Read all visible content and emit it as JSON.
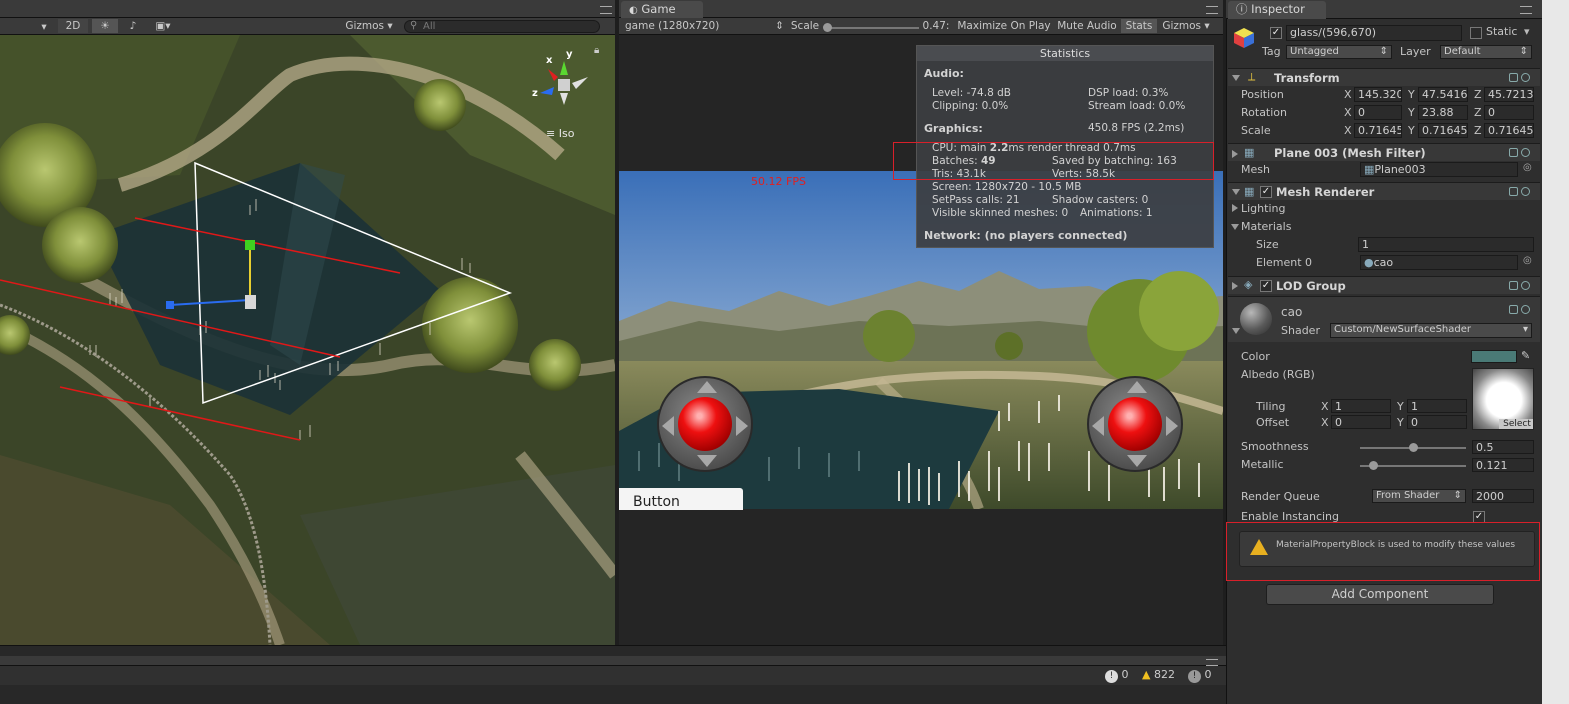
{
  "scene_view": {
    "toolbar": {
      "mode_2d": "2D",
      "gizmos": "Gizmos",
      "search_placeholder": "All"
    },
    "iso_label": "Iso",
    "axis_x": "x",
    "axis_y": "y",
    "axis_z": "z"
  },
  "game_view": {
    "tab_title": "Game",
    "resolution": "game (1280x720)",
    "scale_label": "Scale",
    "scale_value": "0.47:",
    "maximize": "Maximize On Play",
    "mute": "Mute Audio",
    "stats": "Stats",
    "gizmos": "Gizmos",
    "fps_overlay": "50.12 FPS",
    "ui_button": "Button"
  },
  "statistics": {
    "title": "Statistics",
    "audio_heading": "Audio:",
    "level": "Level: -74.8 dB",
    "dsp_load": "DSP load: 0.3%",
    "clipping": "Clipping: 0.0%",
    "stream_load": "Stream load: 0.0%",
    "graphics_heading": "Graphics:",
    "fps": "450.8 FPS (2.2ms)",
    "cpu_prefix": "CPU: main ",
    "cpu_main": "2.2",
    "cpu_suffix": "ms  render thread 0.7ms",
    "batches_prefix": "Batches: ",
    "batches": "49",
    "saved_batching": "Saved by batching: 163",
    "tris": "Tris: 43.1k",
    "verts": "Verts: 58.5k",
    "screen": "Screen: 1280x720 - 10.5 MB",
    "setpass": "SetPass calls: 21",
    "shadow_casters": "Shadow casters: 0",
    "visible_skinned": "Visible skinned meshes: 0",
    "animations": "Animations: 1",
    "network": "Network: (no players connected)"
  },
  "inspector": {
    "tab_title": "Inspector",
    "object_name": "glass/(596,670)",
    "static_label": "Static",
    "tag_label": "Tag",
    "tag_value": "Untagged",
    "layer_label": "Layer",
    "layer_value": "Default",
    "transform": {
      "title": "Transform",
      "position_label": "Position",
      "rotation_label": "Rotation",
      "scale_label": "Scale",
      "x": "X",
      "y": "Y",
      "z": "Z",
      "position": [
        "145.320",
        "47.5416",
        "45.7213"
      ],
      "rotation": [
        "0",
        "23.88",
        "0"
      ],
      "scale": [
        "0.71645",
        "0.71645",
        "0.71645"
      ]
    },
    "mesh_filter": {
      "title": "Plane 003 (Mesh Filter)",
      "mesh_label": "Mesh",
      "mesh_value": "Plane003"
    },
    "mesh_renderer": {
      "title": "Mesh Renderer",
      "lighting": "Lighting",
      "materials": "Materials",
      "size_label": "Size",
      "size_value": "1",
      "element_label": "Element 0",
      "element_value": "cao"
    },
    "lod_group": {
      "title": "LOD Group"
    },
    "material": {
      "name": "cao",
      "shader_label": "Shader",
      "shader_value": "Custom/NewSurfaceShader",
      "color_label": "Color",
      "albedo_label": "Albedo (RGB)",
      "tiling_label": "Tiling",
      "offset_label": "Offset",
      "tiling": [
        "1",
        "1"
      ],
      "offset": [
        "0",
        "0"
      ],
      "select": "Select",
      "smoothness_label": "Smoothness",
      "smoothness_value": "0.5",
      "smoothness_level": 0.5,
      "metallic_label": "Metallic",
      "metallic_value": "0.121",
      "metallic_level": 0.121,
      "render_queue_label": "Render Queue",
      "render_queue_mode": "From Shader",
      "render_queue_value": "2000",
      "instancing_label": "Enable Instancing",
      "warning": "MaterialPropertyBlock is used to modify these values"
    },
    "add_component": "Add Component"
  },
  "console": {
    "errors": "0",
    "warnings": "822",
    "messages": "0"
  },
  "colors": {
    "highlight_box": "#d8202a",
    "fps_overlay": "#e02020",
    "material_color": "#4a7a76"
  }
}
